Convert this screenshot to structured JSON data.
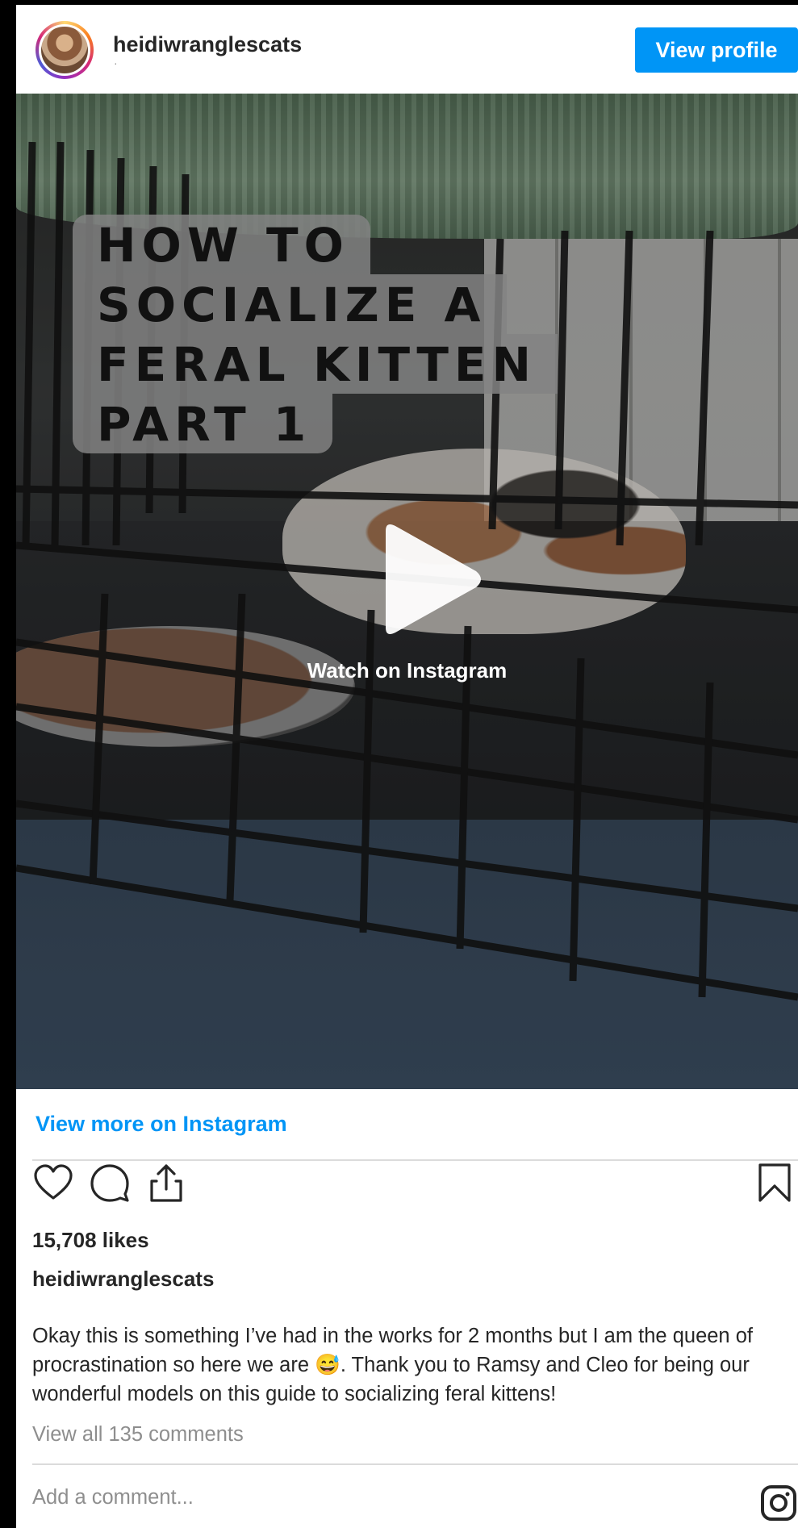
{
  "header": {
    "username": "heidiwranglescats",
    "subtitle": "·",
    "view_profile_label": "View profile"
  },
  "media": {
    "overlay_title_lines": [
      "HOW TO",
      "SOCIALIZE A",
      "FERAL KITTEN",
      "PART 1"
    ],
    "watch_label": "Watch on Instagram"
  },
  "footer": {
    "view_more_label": "View more on Instagram",
    "likes": "15,708 likes",
    "caption_user": "heidiwranglescats",
    "caption": "Okay this is something I’ve had in the works for 2 months but I am the queen of procrastination so here we are 😅. Thank you to Ramsy and Cleo for being our wonderful models on this guide to socializing feral kittens!",
    "view_comments": "View all 135 comments",
    "add_comment_placeholder": "Add a comment..."
  },
  "icons": {
    "like": "heart-icon",
    "comment": "comment-bubble-icon",
    "share": "share-icon",
    "save": "bookmark-icon",
    "play": "play-icon",
    "brand": "instagram-logo-icon"
  },
  "colors": {
    "accent": "#0095f6",
    "text": "#262626",
    "muted": "#8e8e8e"
  }
}
